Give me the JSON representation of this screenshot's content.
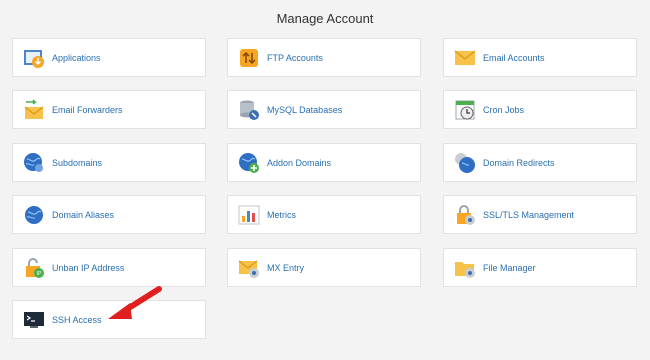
{
  "title": "Manage Account",
  "items": [
    {
      "label": "Applications",
      "icon": "applications-icon"
    },
    {
      "label": "FTP Accounts",
      "icon": "ftp-accounts-icon"
    },
    {
      "label": "Email Accounts",
      "icon": "email-accounts-icon"
    },
    {
      "label": "Email Forwarders",
      "icon": "email-forwarders-icon"
    },
    {
      "label": "MySQL Databases",
      "icon": "mysql-databases-icon"
    },
    {
      "label": "Cron Jobs",
      "icon": "cron-jobs-icon"
    },
    {
      "label": "Subdomains",
      "icon": "subdomains-icon"
    },
    {
      "label": "Addon Domains",
      "icon": "addon-domains-icon"
    },
    {
      "label": "Domain Redirects",
      "icon": "domain-redirects-icon"
    },
    {
      "label": "Domain Aliases",
      "icon": "domain-aliases-icon"
    },
    {
      "label": "Metrics",
      "icon": "metrics-icon"
    },
    {
      "label": "SSL/TLS Management",
      "icon": "ssl-tls-icon"
    },
    {
      "label": "Unban IP Address",
      "icon": "unban-ip-icon"
    },
    {
      "label": "MX Entry",
      "icon": "mx-entry-icon"
    },
    {
      "label": "File Manager",
      "icon": "file-manager-icon"
    },
    {
      "label": "SSH Access",
      "icon": "ssh-access-icon"
    }
  ],
  "annotation": {
    "icon": "red-arrow-icon",
    "color": "#e02020"
  }
}
